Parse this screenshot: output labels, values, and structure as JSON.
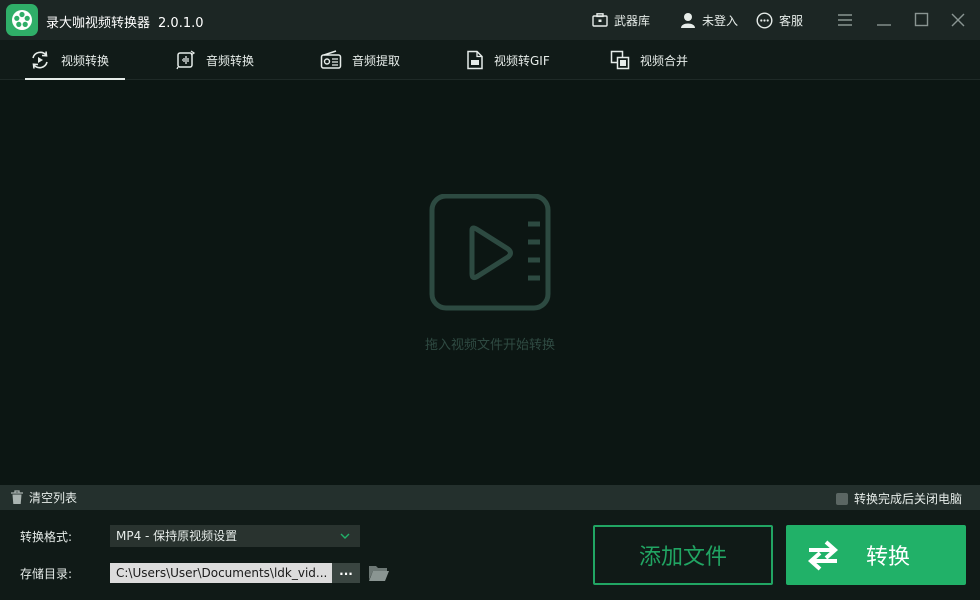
{
  "app": {
    "title": "录大咖视频转换器",
    "version": "2.0.1.0"
  },
  "titlebar": {
    "arsenal": "武器库",
    "login": "未登入",
    "service": "客服"
  },
  "tabs": [
    {
      "label": "视频转换",
      "icon": "video-convert-icon",
      "active": true
    },
    {
      "label": "音频转换",
      "icon": "audio-convert-icon"
    },
    {
      "label": "音频提取",
      "icon": "audio-extract-icon"
    },
    {
      "label": "视频转GIF",
      "icon": "gif-icon"
    },
    {
      "label": "视频合并",
      "icon": "merge-icon"
    }
  ],
  "dropzone": {
    "hint": "拖入视频文件开始转换"
  },
  "listbar": {
    "clear": "清空列表",
    "shutdown": "转换完成后关闭电脑",
    "shutdown_checked": false
  },
  "settings": {
    "format_label": "转换格式:",
    "format_value": "MP4 - 保持原视频设置",
    "dir_label": "存储目录:",
    "dir_value": "C:\\Users\\User\\Documents\\ldk_vid...",
    "browse": "..."
  },
  "actions": {
    "add": "添加文件",
    "convert": "转换"
  },
  "colors": {
    "accent": "#21b168",
    "background": "#0c1613"
  }
}
